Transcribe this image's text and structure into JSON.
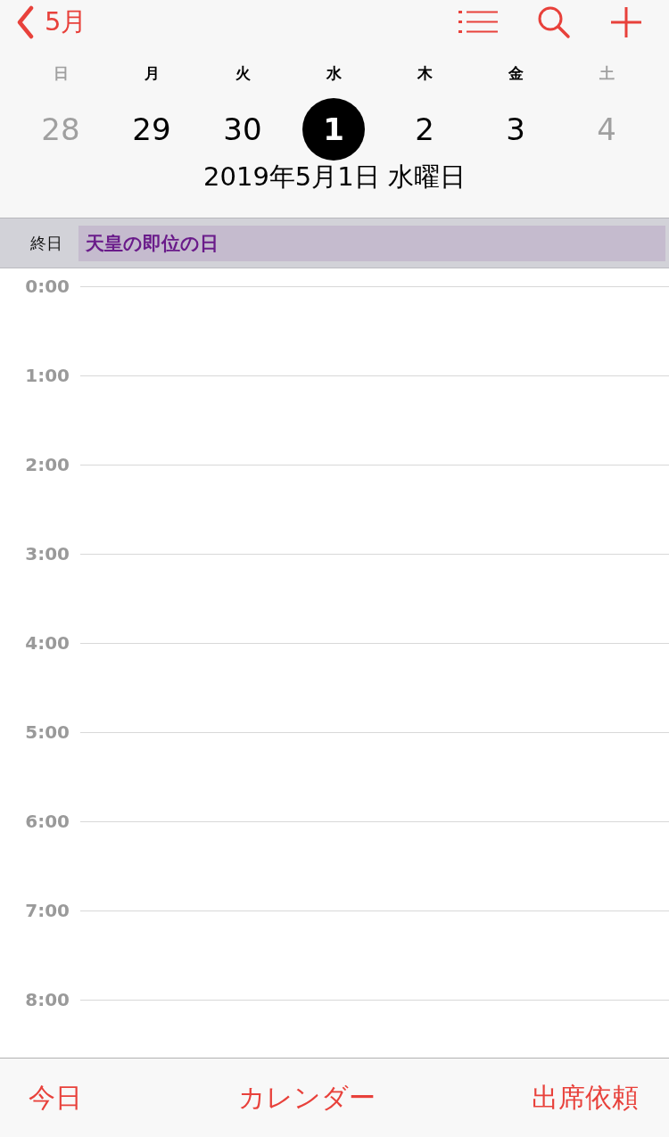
{
  "nav": {
    "back_label": "5月"
  },
  "week": [
    {
      "weekday": "日",
      "day": "28",
      "dimmed": true,
      "selected": false
    },
    {
      "weekday": "月",
      "day": "29",
      "dimmed": false,
      "selected": false
    },
    {
      "weekday": "火",
      "day": "30",
      "dimmed": false,
      "selected": false
    },
    {
      "weekday": "水",
      "day": "1",
      "dimmed": false,
      "selected": true
    },
    {
      "weekday": "木",
      "day": "2",
      "dimmed": false,
      "selected": false
    },
    {
      "weekday": "金",
      "day": "3",
      "dimmed": false,
      "selected": false
    },
    {
      "weekday": "土",
      "day": "4",
      "dimmed": true,
      "selected": false
    }
  ],
  "selected_date": "2019年5月1日 水曜日",
  "all_day": {
    "label": "終日",
    "events": [
      {
        "title": "天皇の即位の日",
        "color": "#6a1b8a"
      }
    ]
  },
  "hours": [
    "0:00",
    "1:00",
    "2:00",
    "3:00",
    "4:00",
    "5:00",
    "6:00",
    "7:00",
    "8:00"
  ],
  "toolbar": [
    "今日",
    "カレンダー",
    "出席依頼"
  ]
}
